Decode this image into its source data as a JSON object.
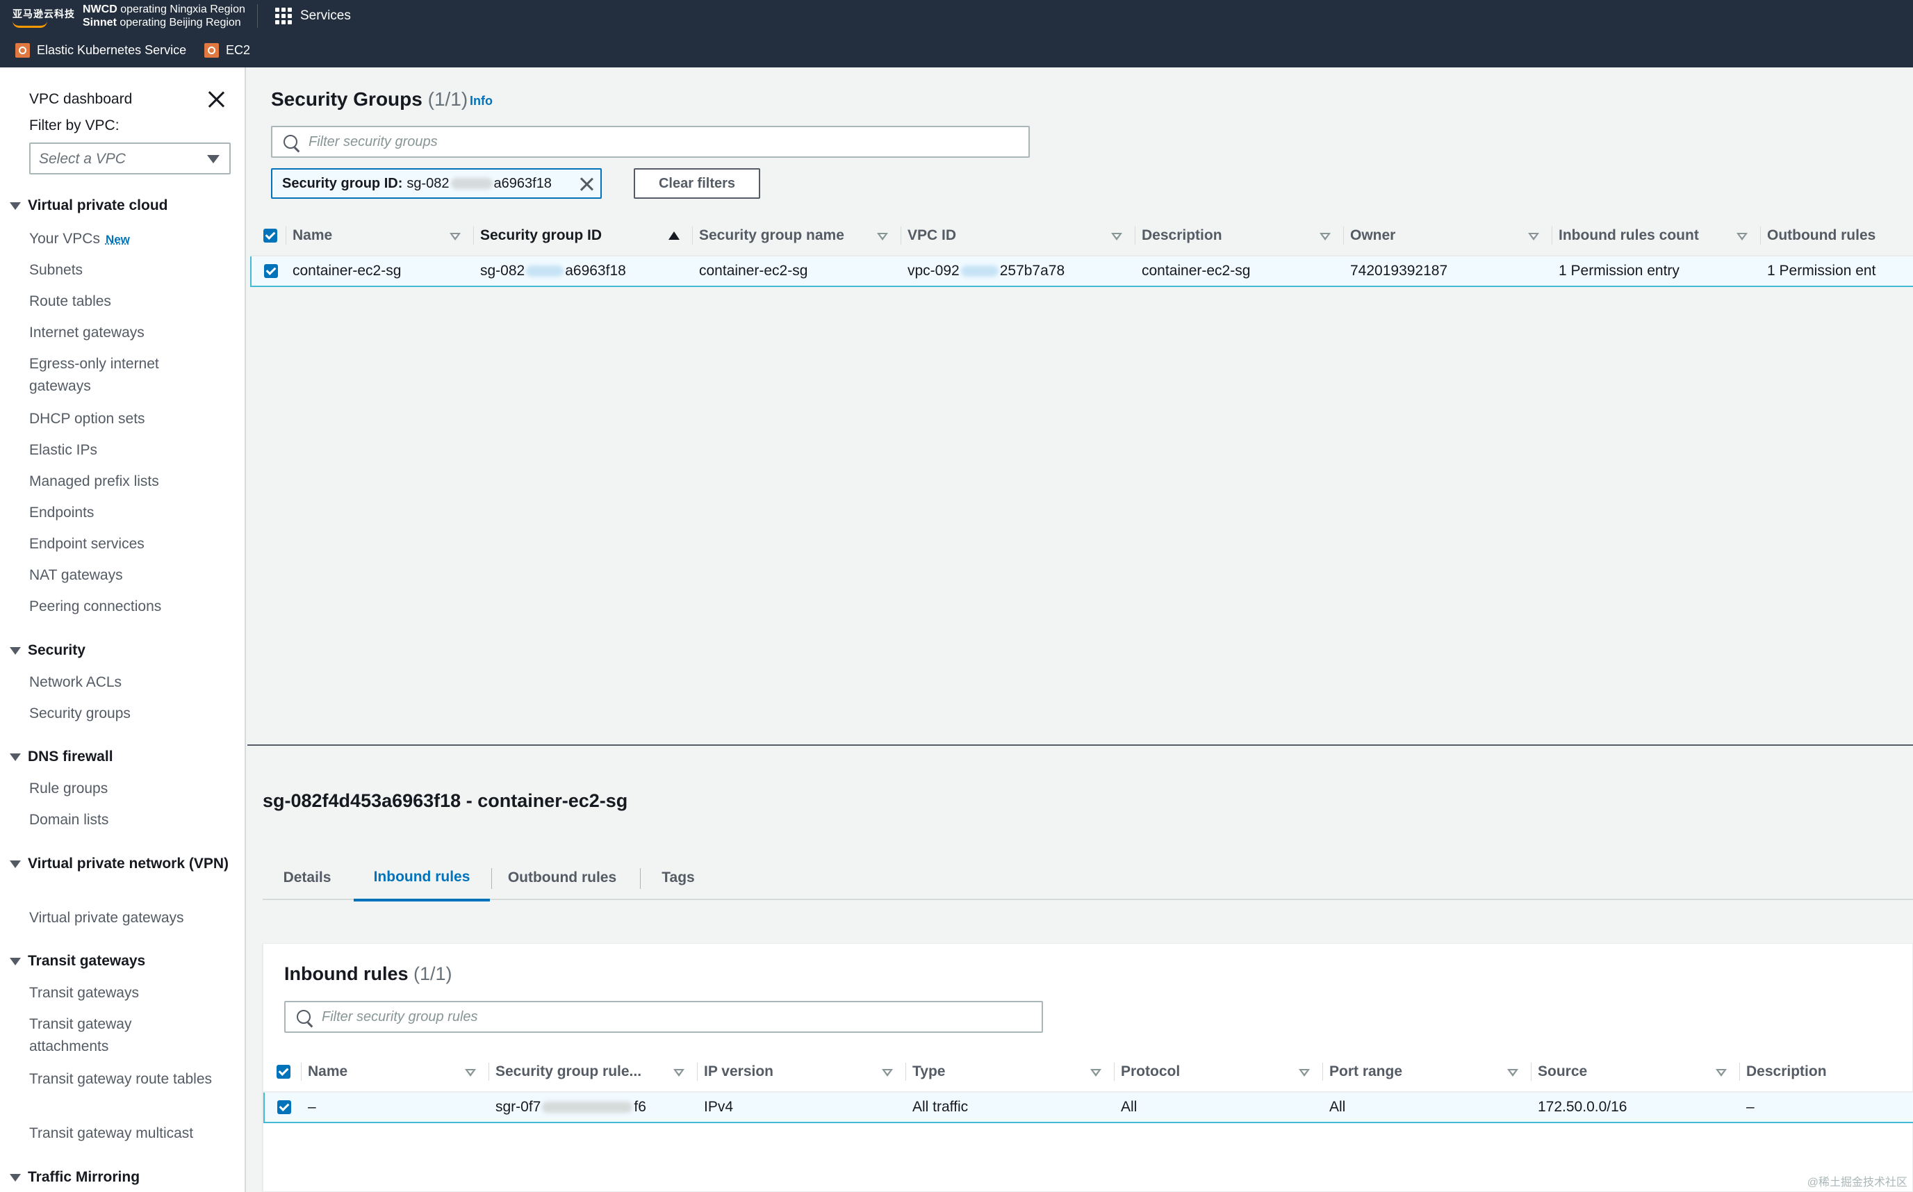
{
  "topnav": {
    "logo_text": "亚马逊云科技",
    "region_line1_bold": "NWCD",
    "region_line1": "operating Ningxia Region",
    "region_line2_bold": "Sinnet",
    "region_line2": "operating Beijing Region",
    "services_label": "Services",
    "favorites": [
      "Elastic Kubernetes Service",
      "EC2"
    ]
  },
  "sidebar": {
    "dashboard": "VPC dashboard",
    "filter_label": "Filter by VPC:",
    "filter_placeholder": "Select a VPC",
    "new_badge": "New",
    "sections": [
      {
        "title": "Virtual private cloud",
        "items": [
          "Your VPCs",
          "Subnets",
          "Route tables",
          "Internet gateways",
          "Egress-only internet gateways",
          "DHCP option sets",
          "Elastic IPs",
          "Managed prefix lists",
          "Endpoints",
          "Endpoint services",
          "NAT gateways",
          "Peering connections"
        ]
      },
      {
        "title": "Security",
        "items": [
          "Network ACLs",
          "Security groups"
        ]
      },
      {
        "title": "DNS firewall",
        "items": [
          "Rule groups",
          "Domain lists"
        ]
      },
      {
        "title": "Virtual private network (VPN)",
        "items": [
          "Virtual private gateways"
        ]
      },
      {
        "title": "Transit gateways",
        "items": [
          "Transit gateways",
          "Transit gateway attachments",
          "Transit gateway route tables",
          "Transit gateway multicast"
        ]
      },
      {
        "title": "Traffic Mirroring",
        "items": []
      }
    ]
  },
  "main": {
    "title": "Security Groups",
    "count": "(1/1)",
    "info": "Info",
    "search_placeholder": "Filter security groups",
    "token_label": "Security group ID:",
    "token_value_prefix": "sg-082",
    "token_value_suffix": "a6963f18",
    "clear_filters": "Clear filters",
    "columns": [
      "Name",
      "Security group ID",
      "Security group name",
      "VPC ID",
      "Description",
      "Owner",
      "Inbound rules count",
      "Outbound rules"
    ],
    "rows": [
      {
        "name": "container-ec2-sg",
        "sg_id_prefix": "sg-082",
        "sg_id_suffix": "a6963f18",
        "sg_name": "container-ec2-sg",
        "vpc_id_prefix": "vpc-092",
        "vpc_id_suffix": "257b7a78",
        "description": "container-ec2-sg",
        "owner": "742019392187",
        "inbound_count": "1 Permission entry",
        "outbound_count": "1 Permission ent"
      }
    ]
  },
  "detail": {
    "title": "sg-082f4d453a6963f18 - container-ec2-sg",
    "tabs": [
      "Details",
      "Inbound rules",
      "Outbound rules",
      "Tags"
    ],
    "active_tab": "Inbound rules",
    "inbound": {
      "title": "Inbound rules",
      "count": "(1/1)",
      "search_placeholder": "Filter security group rules",
      "columns": [
        "Name",
        "Security group rule...",
        "IP version",
        "Type",
        "Protocol",
        "Port range",
        "Source",
        "Description"
      ],
      "rows": [
        {
          "name": "–",
          "rule_id_prefix": "sgr-0f7",
          "rule_id_suffix": "f6",
          "ip_version": "IPv4",
          "type": "All traffic",
          "protocol": "All",
          "port_range": "All",
          "source": "172.50.0.0/16",
          "description": "–"
        }
      ]
    }
  },
  "watermark": "@稀土掘金技术社区",
  "colors": {
    "nav_bg": "#232f3e",
    "accent": "#0073bb",
    "selected_row_bg": "#f1faff",
    "selected_row_border": "#44b9d6"
  }
}
